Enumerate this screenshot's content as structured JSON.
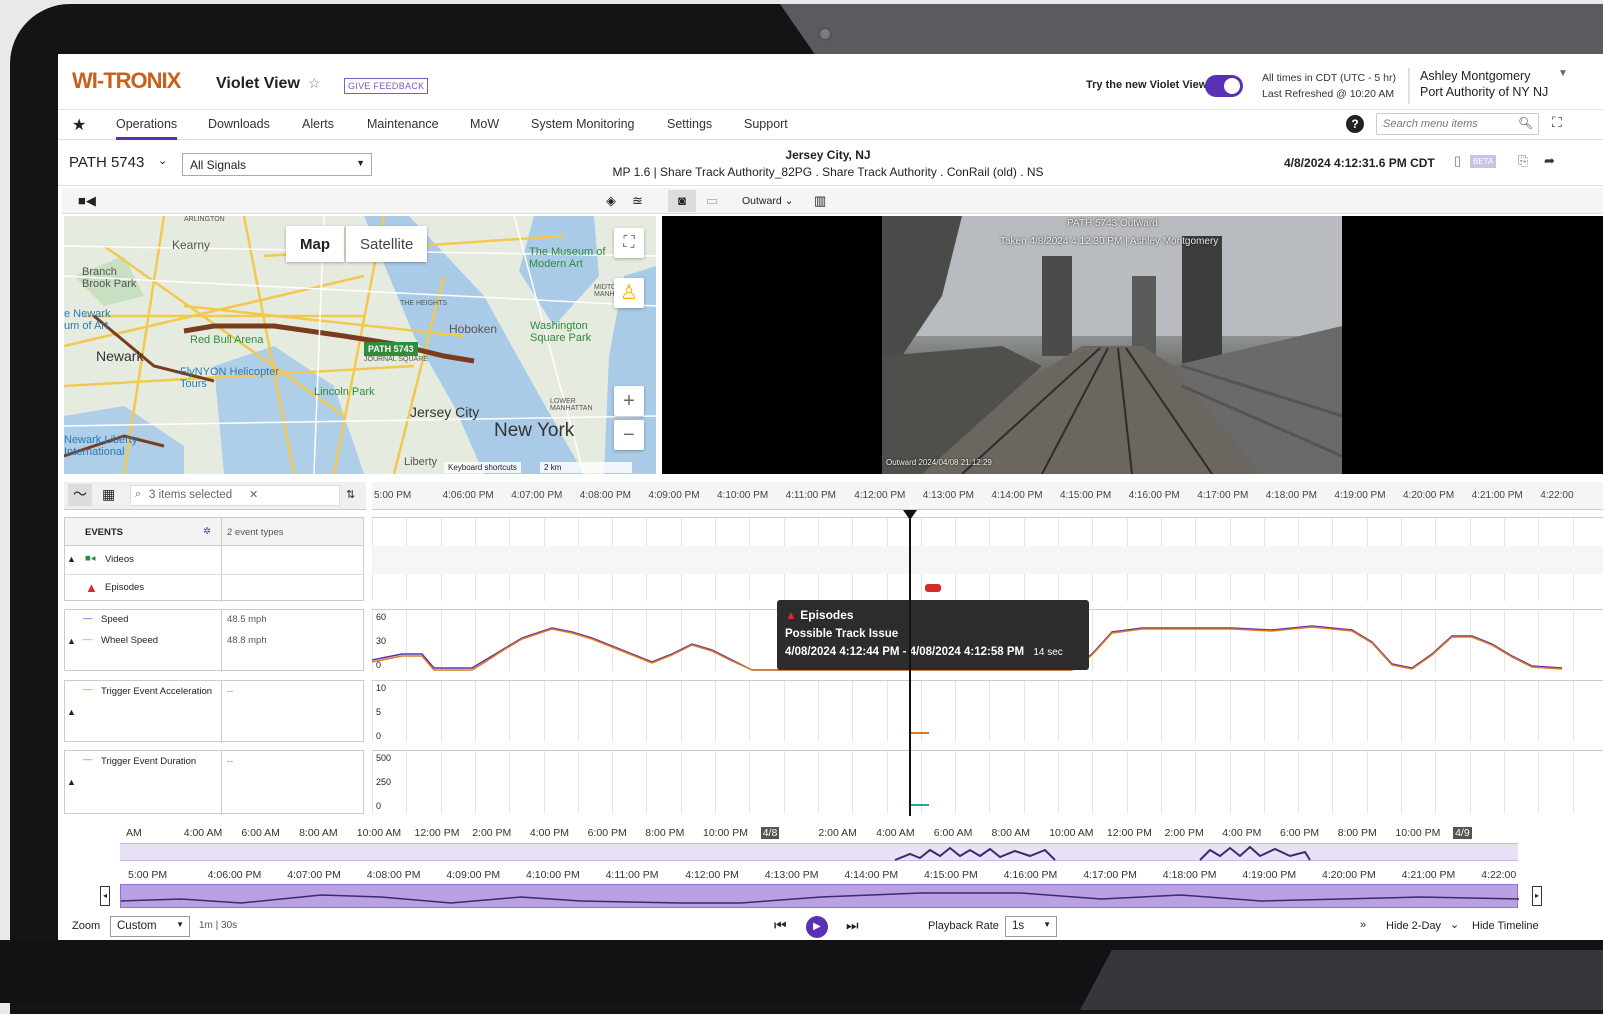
{
  "header": {
    "logo": "WI-TRONIX",
    "app_title": "Violet View",
    "feedback": "GIVE FEEDBACK",
    "try_new": "Try the new Violet View",
    "times_line1": "All times in CDT (UTC - 5 hr)",
    "times_line2": "Last Refreshed @ 10:20 AM",
    "user_name": "Ashley Montgomery",
    "user_org": "Port Authority of NY NJ"
  },
  "nav": {
    "items": [
      "Operations",
      "Downloads",
      "Alerts",
      "Maintenance",
      "MoW",
      "System Monitoring",
      "Settings",
      "Support"
    ],
    "search_placeholder": "Search menu items"
  },
  "sub": {
    "vehicle": "PATH 5743",
    "signals": "All Signals",
    "location_title": "Jersey City, NJ",
    "location_detail": "MP 1.6 | Share Track Authority_82PG . Share Track Authority . ConRail (old) . NS",
    "timestamp": "4/8/2024 4:12:31.6 PM CDT",
    "beta": "BETA"
  },
  "map": {
    "tab_map": "Map",
    "tab_satellite": "Satellite",
    "marker": "PATH 5743",
    "labels": {
      "kearny": "Kearny",
      "newark": "Newark",
      "hoboken": "Hoboken",
      "jersey_city": "Jersey City",
      "new_york": "New York",
      "branch_brook": "Branch Brook Park",
      "red_bull": "Red Bull Arena",
      "moma": "The Museum of Modern Art",
      "washington": "Washington Square Park",
      "lincoln": "Lincoln Park",
      "flynyon": "FlyNYON Helicopter Tours",
      "newark_airport": "Newark Liberty International",
      "liberty": "Liberty",
      "keyboard": "Keyboard shortcuts",
      "scale": "2 km",
      "arlington": "ARLINGTON",
      "heights": "THE HEIGHTS",
      "midtown": "MIDTOWN MANHATTAN",
      "journal": "JOURNAL SQUARE",
      "lower": "LOWER MANHATTAN",
      "museum_art": "e Newark um of Art"
    }
  },
  "video": {
    "direction": "Outward",
    "overlay_title": "PATH 5743 Outward",
    "overlay_sub": "Taken 4/8/2024 4:12:30 PM | Ashley Montgomery",
    "overlay_bottom": "Outward 2024/04/08 21:12:29"
  },
  "timeline": {
    "selected": "3 items selected",
    "ticks": [
      "5:00 PM",
      "4:06:00 PM",
      "4:07:00 PM",
      "4:08:00 PM",
      "4:09:00 PM",
      "4:10:00 PM",
      "4:11:00 PM",
      "4:12:00 PM",
      "4:13:00 PM",
      "4:14:00 PM",
      "4:15:00 PM",
      "4:16:00 PM",
      "4:17:00 PM",
      "4:18:00 PM",
      "4:19:00 PM",
      "4:20:00 PM",
      "4:21:00 PM",
      "4:22:00"
    ],
    "events_label": "EVENTS",
    "events_types": "2 event types",
    "videos_label": "Videos",
    "episodes_label": "Episodes",
    "speed_label": "Speed",
    "speed_value": "48.5 mph",
    "wheel_label": "Wheel Speed",
    "wheel_value": "48.8 mph",
    "tea_label": "Trigger Event Acceleration",
    "tea_value": "--",
    "ted_label": "Trigger Event Duration",
    "ted_value": "--",
    "speed_axis": [
      "60",
      "30",
      "0"
    ],
    "acc_axis": [
      "10",
      "5",
      "0"
    ],
    "dur_axis": [
      "500",
      "250",
      "0"
    ]
  },
  "tooltip": {
    "title": "Episodes",
    "name": "Possible Track Issue",
    "range": "4/08/2024 4:12:44 PM - 4/08/2024 4:12:58 PM",
    "duration": "14 sec"
  },
  "overview": {
    "labels": [
      "AM",
      "4:00 AM",
      "6:00 AM",
      "8:00 AM",
      "10:00 AM",
      "12:00 PM",
      "2:00 PM",
      "4:00 PM",
      "6:00 PM",
      "8:00 PM",
      "10:00 PM",
      "4/8",
      "2:00 AM",
      "4:00 AM",
      "6:00 AM",
      "8:00 AM",
      "10:00 AM",
      "12:00 PM",
      "2:00 PM",
      "4:00 PM",
      "6:00 PM",
      "8:00 PM",
      "10:00 PM",
      "4/9"
    ],
    "labels2": [
      "5:00 PM",
      "4:06:00 PM",
      "4:07:00 PM",
      "4:08:00 PM",
      "4:09:00 PM",
      "4:10:00 PM",
      "4:11:00 PM",
      "4:12:00 PM",
      "4:13:00 PM",
      "4:14:00 PM",
      "4:15:00 PM",
      "4:16:00 PM",
      "4:17:00 PM",
      "4:18:00 PM",
      "4:19:00 PM",
      "4:20:00 PM",
      "4:21:00 PM",
      "4:22:00"
    ]
  },
  "footer": {
    "zoom": "Zoom",
    "zoom_value": "Custom",
    "interval": "1m | 30s",
    "playback": "Playback Rate",
    "rate": "1s",
    "hide2day": "Hide 2-Day",
    "hide_timeline": "Hide Timeline"
  },
  "colors": {
    "accent": "#5a31b5",
    "speed": "#5a31b5",
    "wheel": "#e07a18",
    "alert": "#d62b2b"
  }
}
